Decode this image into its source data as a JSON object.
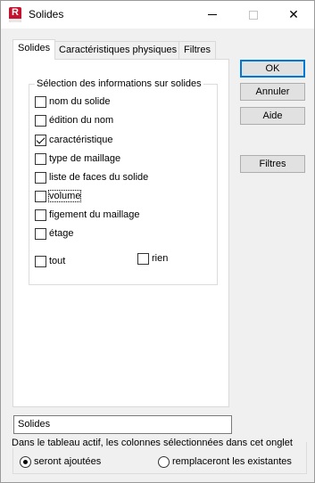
{
  "window": {
    "title": "Solides",
    "icon_letter": "R",
    "close_glyph": "✕"
  },
  "tabs": [
    {
      "label": "Solides",
      "active": true
    },
    {
      "label": "Caractéristiques physiques",
      "active": false
    },
    {
      "label": "Filtres",
      "active": false
    }
  ],
  "selection_group": {
    "legend": "Sélection des informations sur solides",
    "items": [
      {
        "label": "nom du solide",
        "checked": false
      },
      {
        "label": "édition du nom",
        "checked": false
      },
      {
        "label": "caractéristique",
        "checked": true
      },
      {
        "label": "type de maillage",
        "checked": false
      },
      {
        "label": "liste de faces du solide",
        "checked": false
      },
      {
        "label": "volume",
        "checked": false,
        "focused": true
      },
      {
        "label": "figement du maillage",
        "checked": false
      },
      {
        "label": "étage",
        "checked": false
      }
    ],
    "all_label": "tout",
    "none_label": "rien"
  },
  "buttons": {
    "ok": "OK",
    "cancel": "Annuler",
    "help": "Aide",
    "filters": "Filtres"
  },
  "name_field": {
    "value": "Solides"
  },
  "columns_group": {
    "legend": "Dans le tableau actif, les colonnes sélectionnées dans cet onglet",
    "options": [
      {
        "label": "seront ajoutées",
        "selected": true
      },
      {
        "label": "remplaceront les existantes",
        "selected": false
      }
    ]
  },
  "colors": {
    "app_icon": "#c4122f",
    "default_button_border": "#0078d7"
  }
}
